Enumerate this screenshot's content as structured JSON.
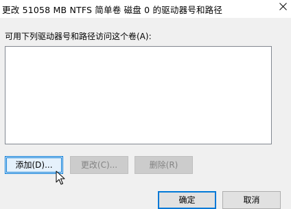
{
  "window": {
    "title": "更改 51058 MB NTFS 简单卷 磁盘 0 的驱动器号和路径"
  },
  "main": {
    "prompt": "可用下列驱动器号和路径访问这个卷(A):",
    "list_items": []
  },
  "buttons": {
    "add": "添加(D)...",
    "change": "更改(C)...",
    "delete": "删除(R)",
    "ok": "确定",
    "cancel": "取消"
  },
  "icons": {
    "close": "close-icon",
    "cursor": "mouse-pointer-icon"
  },
  "colors": {
    "accent": "#0078d7",
    "disabled_text": "#838383"
  }
}
